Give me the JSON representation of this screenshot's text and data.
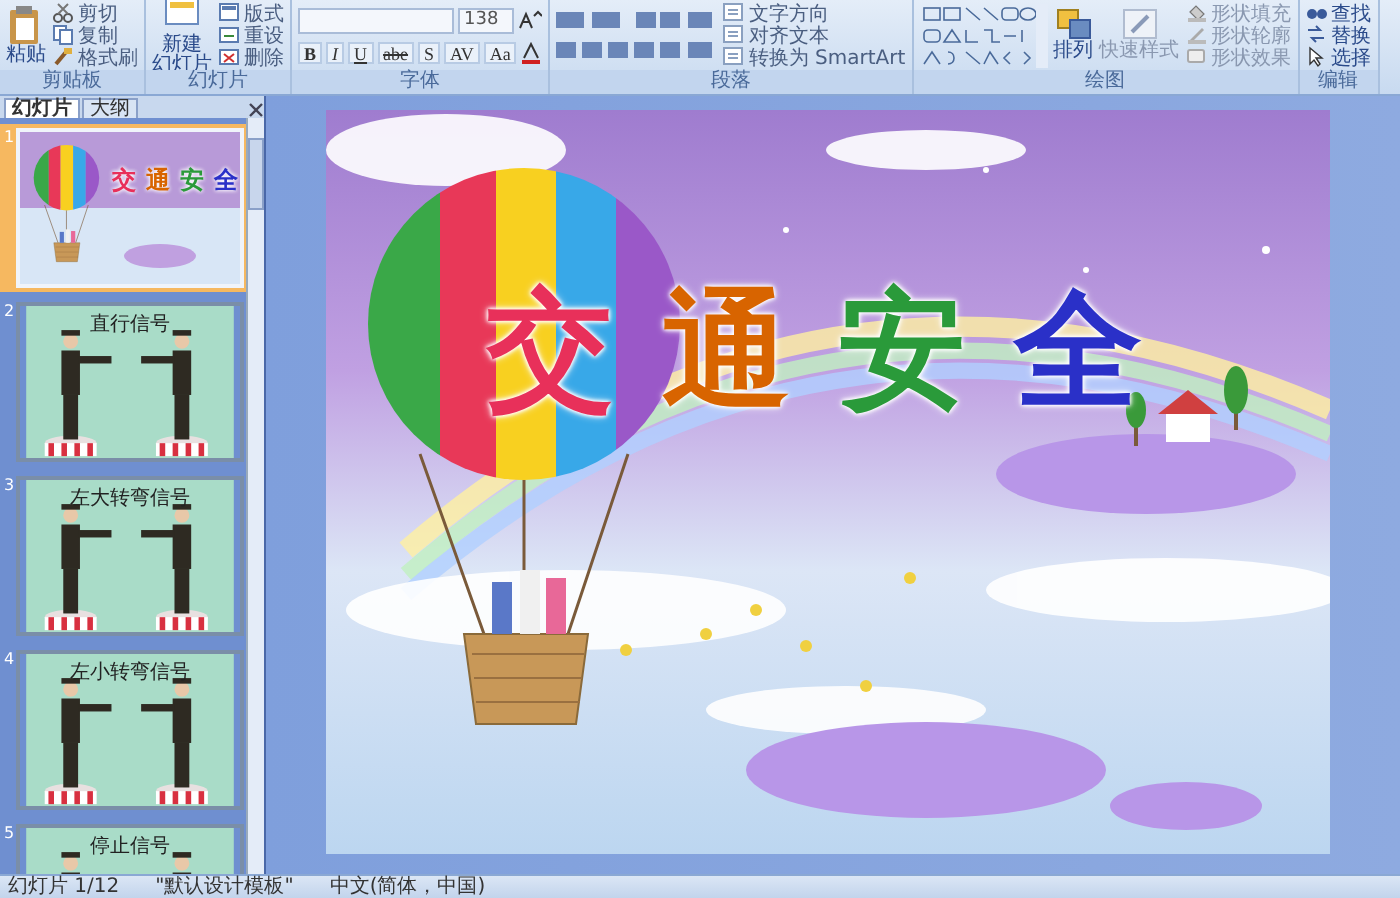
{
  "ribbon": {
    "groups": [
      {
        "kind": "clipboard",
        "label": "剪贴板",
        "big": "粘贴",
        "items": [
          "剪切",
          "复制",
          "格式刷"
        ]
      },
      {
        "kind": "slides",
        "label": "幻灯片",
        "big": [
          "新建",
          "幻灯片"
        ],
        "items": [
          "版式",
          "重设",
          "删除"
        ]
      },
      {
        "kind": "font",
        "label": "字体",
        "size": "138",
        "buttons": [
          "B",
          "I",
          "U",
          "abe",
          "S",
          "AV",
          "Aa"
        ]
      },
      {
        "kind": "paragraph",
        "label": "段落",
        "items": [
          "文字方向",
          "对齐文本",
          "转换为 SmartArt"
        ]
      },
      {
        "kind": "drawing",
        "label": "绘图",
        "big": "排列",
        "big2": "快速样式",
        "items": [
          "形状填充",
          "形状轮廓",
          "形状效果"
        ]
      },
      {
        "kind": "editing",
        "label": "编辑",
        "items": [
          "查找",
          "替换",
          "选择"
        ]
      }
    ]
  },
  "panel": {
    "tabs": [
      {
        "label": "幻灯片",
        "selected": true
      },
      {
        "label": "大纲",
        "selected": false
      }
    ],
    "slides": [
      {
        "number": "1",
        "kind": "title",
        "selected": true,
        "title_chars": [
          {
            "char": "交",
            "color": "#e8305a"
          },
          {
            "char": "通",
            "color": "#d86400"
          },
          {
            "char": "安",
            "color": "#2a9a3a"
          },
          {
            "char": "全",
            "color": "#2a30c8"
          }
        ]
      },
      {
        "number": "2",
        "kind": "signal",
        "selected": false,
        "title": "直行信号"
      },
      {
        "number": "3",
        "kind": "signal",
        "selected": false,
        "title": "左大转弯信号"
      },
      {
        "number": "4",
        "kind": "signal",
        "selected": false,
        "title": "左小转弯信号"
      },
      {
        "number": "5",
        "kind": "signal",
        "selected": false,
        "title": "停止信号"
      }
    ]
  },
  "slide": {
    "title": [
      {
        "char": "交",
        "color": "#e8305a"
      },
      {
        "char": "通",
        "color": "#d86400"
      },
      {
        "char": "安",
        "color": "#2a9a3a"
      },
      {
        "char": "全",
        "color": "#2a30c8"
      }
    ]
  },
  "status_bar": {
    "slide": "幻灯片 1/12",
    "theme": "\"默认设计模板\"",
    "language": "中文(简体，中国)"
  }
}
